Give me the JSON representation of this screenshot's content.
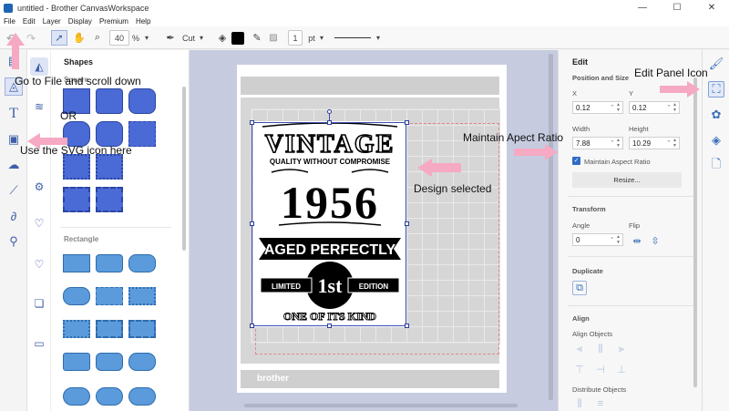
{
  "window": {
    "title": "untitled - Brother CanvasWorkspace"
  },
  "menu": [
    "File",
    "Edit",
    "Layer",
    "Display",
    "Premium",
    "Help"
  ],
  "toolbar": {
    "zoom": "40",
    "zoom_unit": "%",
    "mode": "Cut",
    "stroke_width": "1",
    "stroke_unit": "pt",
    "fill_color": "#000000"
  },
  "shapes_panel": {
    "title": "Shapes",
    "section1": "Square",
    "section2": "Rectangle",
    "shape_color": "#4a6bd6",
    "rect_color": "#5b9bdb"
  },
  "design": {
    "line1": "VINTAGE",
    "line2": "QUALITY WITHOUT COMPROMISE",
    "line3": "1956",
    "line4": "AGED PERFECTLY",
    "line5": "LIMITED",
    "line6": "1st",
    "line7": "EDITION",
    "line8": "ONE OF ITS KIND",
    "mat_logo": "brother"
  },
  "edit_panel": {
    "title": "Edit",
    "pos_size": "Position and Size",
    "x_label": "X",
    "x_value": "0.12",
    "y_label": "Y",
    "y_value": "0.12",
    "unit": "\"",
    "width_label": "Width",
    "width_value": "7.88",
    "height_label": "Height",
    "height_value": "10.29",
    "aspect_label": "Maintain Aspect Ratio",
    "resize_button": "Resize...",
    "transform": "Transform",
    "angle_label": "Angle",
    "angle_value": "0",
    "flip_label": "Flip",
    "duplicate": "Duplicate",
    "align": "Align",
    "align_objects": "Align Objects",
    "distribute_objects": "Distribute Objects"
  },
  "annotations": {
    "file_note": "Go to File and scroll down",
    "or_note": "OR",
    "svg_note": "Use the SVG icon here",
    "design_note": "Design selected",
    "aspect_note": "Maintain Apect Ratio",
    "edit_icon_note": "Edit Panel Icon",
    "arrow_color": "#f6a9c2"
  }
}
